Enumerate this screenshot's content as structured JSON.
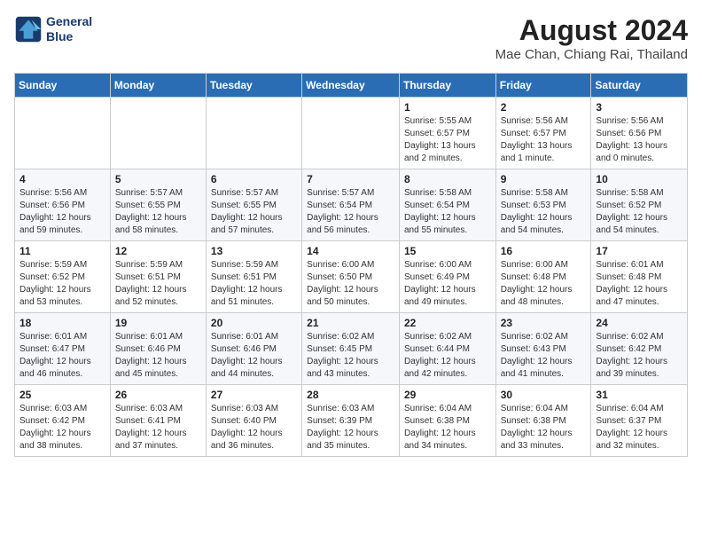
{
  "header": {
    "logo_line1": "General",
    "logo_line2": "Blue",
    "month_year": "August 2024",
    "location": "Mae Chan, Chiang Rai, Thailand"
  },
  "weekdays": [
    "Sunday",
    "Monday",
    "Tuesday",
    "Wednesday",
    "Thursday",
    "Friday",
    "Saturday"
  ],
  "weeks": [
    [
      {
        "day": "",
        "info": ""
      },
      {
        "day": "",
        "info": ""
      },
      {
        "day": "",
        "info": ""
      },
      {
        "day": "",
        "info": ""
      },
      {
        "day": "1",
        "info": "Sunrise: 5:55 AM\nSunset: 6:57 PM\nDaylight: 13 hours\nand 2 minutes."
      },
      {
        "day": "2",
        "info": "Sunrise: 5:56 AM\nSunset: 6:57 PM\nDaylight: 13 hours\nand 1 minute."
      },
      {
        "day": "3",
        "info": "Sunrise: 5:56 AM\nSunset: 6:56 PM\nDaylight: 13 hours\nand 0 minutes."
      }
    ],
    [
      {
        "day": "4",
        "info": "Sunrise: 5:56 AM\nSunset: 6:56 PM\nDaylight: 12 hours\nand 59 minutes."
      },
      {
        "day": "5",
        "info": "Sunrise: 5:57 AM\nSunset: 6:55 PM\nDaylight: 12 hours\nand 58 minutes."
      },
      {
        "day": "6",
        "info": "Sunrise: 5:57 AM\nSunset: 6:55 PM\nDaylight: 12 hours\nand 57 minutes."
      },
      {
        "day": "7",
        "info": "Sunrise: 5:57 AM\nSunset: 6:54 PM\nDaylight: 12 hours\nand 56 minutes."
      },
      {
        "day": "8",
        "info": "Sunrise: 5:58 AM\nSunset: 6:54 PM\nDaylight: 12 hours\nand 55 minutes."
      },
      {
        "day": "9",
        "info": "Sunrise: 5:58 AM\nSunset: 6:53 PM\nDaylight: 12 hours\nand 54 minutes."
      },
      {
        "day": "10",
        "info": "Sunrise: 5:58 AM\nSunset: 6:52 PM\nDaylight: 12 hours\nand 54 minutes."
      }
    ],
    [
      {
        "day": "11",
        "info": "Sunrise: 5:59 AM\nSunset: 6:52 PM\nDaylight: 12 hours\nand 53 minutes."
      },
      {
        "day": "12",
        "info": "Sunrise: 5:59 AM\nSunset: 6:51 PM\nDaylight: 12 hours\nand 52 minutes."
      },
      {
        "day": "13",
        "info": "Sunrise: 5:59 AM\nSunset: 6:51 PM\nDaylight: 12 hours\nand 51 minutes."
      },
      {
        "day": "14",
        "info": "Sunrise: 6:00 AM\nSunset: 6:50 PM\nDaylight: 12 hours\nand 50 minutes."
      },
      {
        "day": "15",
        "info": "Sunrise: 6:00 AM\nSunset: 6:49 PM\nDaylight: 12 hours\nand 49 minutes."
      },
      {
        "day": "16",
        "info": "Sunrise: 6:00 AM\nSunset: 6:48 PM\nDaylight: 12 hours\nand 48 minutes."
      },
      {
        "day": "17",
        "info": "Sunrise: 6:01 AM\nSunset: 6:48 PM\nDaylight: 12 hours\nand 47 minutes."
      }
    ],
    [
      {
        "day": "18",
        "info": "Sunrise: 6:01 AM\nSunset: 6:47 PM\nDaylight: 12 hours\nand 46 minutes."
      },
      {
        "day": "19",
        "info": "Sunrise: 6:01 AM\nSunset: 6:46 PM\nDaylight: 12 hours\nand 45 minutes."
      },
      {
        "day": "20",
        "info": "Sunrise: 6:01 AM\nSunset: 6:46 PM\nDaylight: 12 hours\nand 44 minutes."
      },
      {
        "day": "21",
        "info": "Sunrise: 6:02 AM\nSunset: 6:45 PM\nDaylight: 12 hours\nand 43 minutes."
      },
      {
        "day": "22",
        "info": "Sunrise: 6:02 AM\nSunset: 6:44 PM\nDaylight: 12 hours\nand 42 minutes."
      },
      {
        "day": "23",
        "info": "Sunrise: 6:02 AM\nSunset: 6:43 PM\nDaylight: 12 hours\nand 41 minutes."
      },
      {
        "day": "24",
        "info": "Sunrise: 6:02 AM\nSunset: 6:42 PM\nDaylight: 12 hours\nand 39 minutes."
      }
    ],
    [
      {
        "day": "25",
        "info": "Sunrise: 6:03 AM\nSunset: 6:42 PM\nDaylight: 12 hours\nand 38 minutes."
      },
      {
        "day": "26",
        "info": "Sunrise: 6:03 AM\nSunset: 6:41 PM\nDaylight: 12 hours\nand 37 minutes."
      },
      {
        "day": "27",
        "info": "Sunrise: 6:03 AM\nSunset: 6:40 PM\nDaylight: 12 hours\nand 36 minutes."
      },
      {
        "day": "28",
        "info": "Sunrise: 6:03 AM\nSunset: 6:39 PM\nDaylight: 12 hours\nand 35 minutes."
      },
      {
        "day": "29",
        "info": "Sunrise: 6:04 AM\nSunset: 6:38 PM\nDaylight: 12 hours\nand 34 minutes."
      },
      {
        "day": "30",
        "info": "Sunrise: 6:04 AM\nSunset: 6:38 PM\nDaylight: 12 hours\nand 33 minutes."
      },
      {
        "day": "31",
        "info": "Sunrise: 6:04 AM\nSunset: 6:37 PM\nDaylight: 12 hours\nand 32 minutes."
      }
    ]
  ]
}
